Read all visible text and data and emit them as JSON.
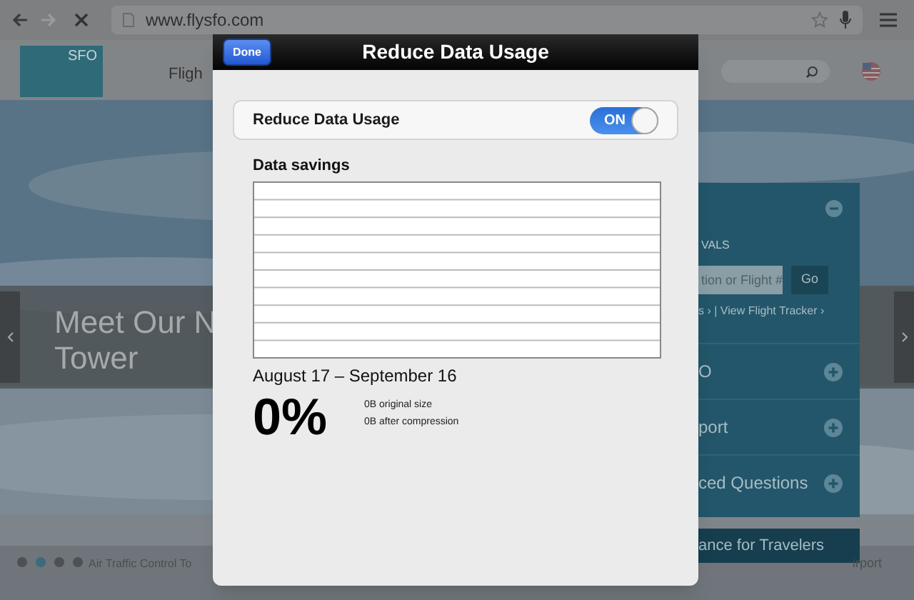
{
  "browser": {
    "url": "www.flysfo.com"
  },
  "site": {
    "logo": "SFO",
    "nav_item": "Fligh",
    "hero": {
      "kind": "picture"
    },
    "banner_lines": [
      "Meet Our N",
      "Tower"
    ],
    "panel": {
      "header_expanded": true,
      "section_label": "VALS",
      "search_placeholder": "tion or Flight #",
      "go": "Go",
      "links": "s › | View Flight Tracker ›",
      "rows": [
        {
          "label": "O",
          "expanded": false
        },
        {
          "label": "port",
          "expanded": false
        },
        {
          "label": "ced Questions",
          "expanded": false
        }
      ]
    },
    "travel_bar": "ance for Travelers",
    "carousel": {
      "dots": [
        {
          "selected": false
        },
        {
          "selected": true
        },
        {
          "selected": false
        },
        {
          "selected": false
        }
      ],
      "caption": "Air Traffic Control To",
      "caption_right": "irport"
    }
  },
  "modal": {
    "title": "Reduce Data Usage",
    "done": "Done",
    "toggle": {
      "label": "Reduce Data Usage",
      "on": true,
      "on_text": "ON"
    },
    "savings_title": "Data savings",
    "period": "August 17 – September 16",
    "percent": "0%",
    "original": "0B original size",
    "compressed": "0B after compression"
  }
}
